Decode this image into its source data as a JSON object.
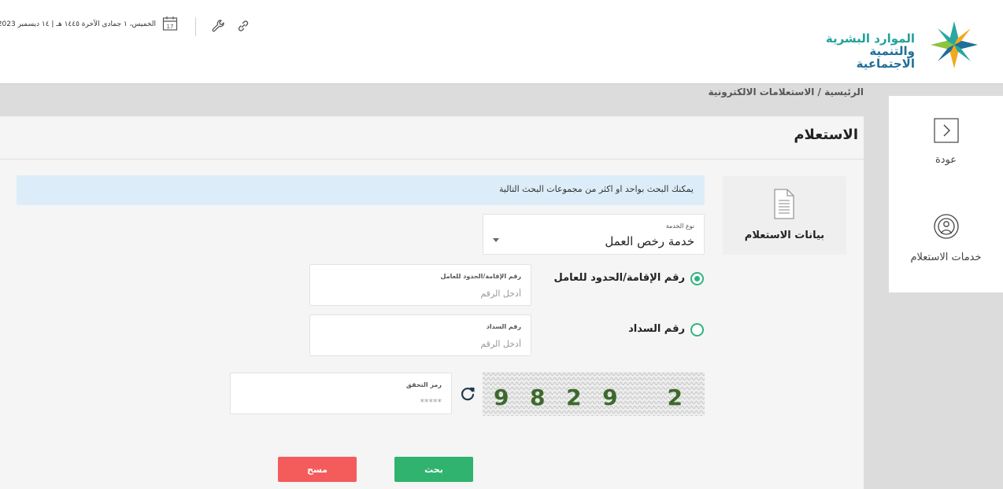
{
  "header": {
    "logo": {
      "line1": "الموارد البشرية",
      "line2": "والتنمية الاجتماعية"
    },
    "date_text": "الخميس، ١ جمادى الآخرة ١٤٤٥ هـ | ١٤ ديسمبر 2023",
    "calendar_day": "17",
    "icons": [
      "link-icon",
      "wrench-icon",
      "calendar-icon"
    ]
  },
  "breadcrumb": "الرئيسية / الاستعلامات الالكترونية",
  "sidebar": {
    "back_label": "عودة",
    "services_label": "خدمات الاستعلام"
  },
  "main": {
    "title": "الاستعلام",
    "info_text": "يمكنك البحث بواحد او اكثر من مجموعات البحث التالية",
    "data_tab_label": "بيانات الاستعلام",
    "service_type": {
      "caption": "نوع الخدمة",
      "value": "خدمة رخص العمل"
    },
    "radio_iqama": {
      "label": "رقم الإقامة/الحدود للعامل",
      "selected": true
    },
    "radio_payment": {
      "label": "رقم السداد",
      "selected": false
    },
    "field_iqama": {
      "caption": "رقم الإقامة/الحدود للعامل",
      "placeholder": "أدخل الرقم"
    },
    "field_payment": {
      "caption": "رقم السداد",
      "placeholder": "أدخل الرقم"
    },
    "field_captcha": {
      "caption": "رمز التحقق",
      "placeholder": "*****"
    },
    "captcha_text": "9829 2",
    "search_button": "بحث",
    "clear_button": "مسح"
  },
  "colors": {
    "accent_green": "#2fb36f",
    "clear_red": "#f45b5b",
    "info_bg": "#dcedf9",
    "logo_teal": "#22a29a",
    "logo_blue": "#1f6f97"
  }
}
